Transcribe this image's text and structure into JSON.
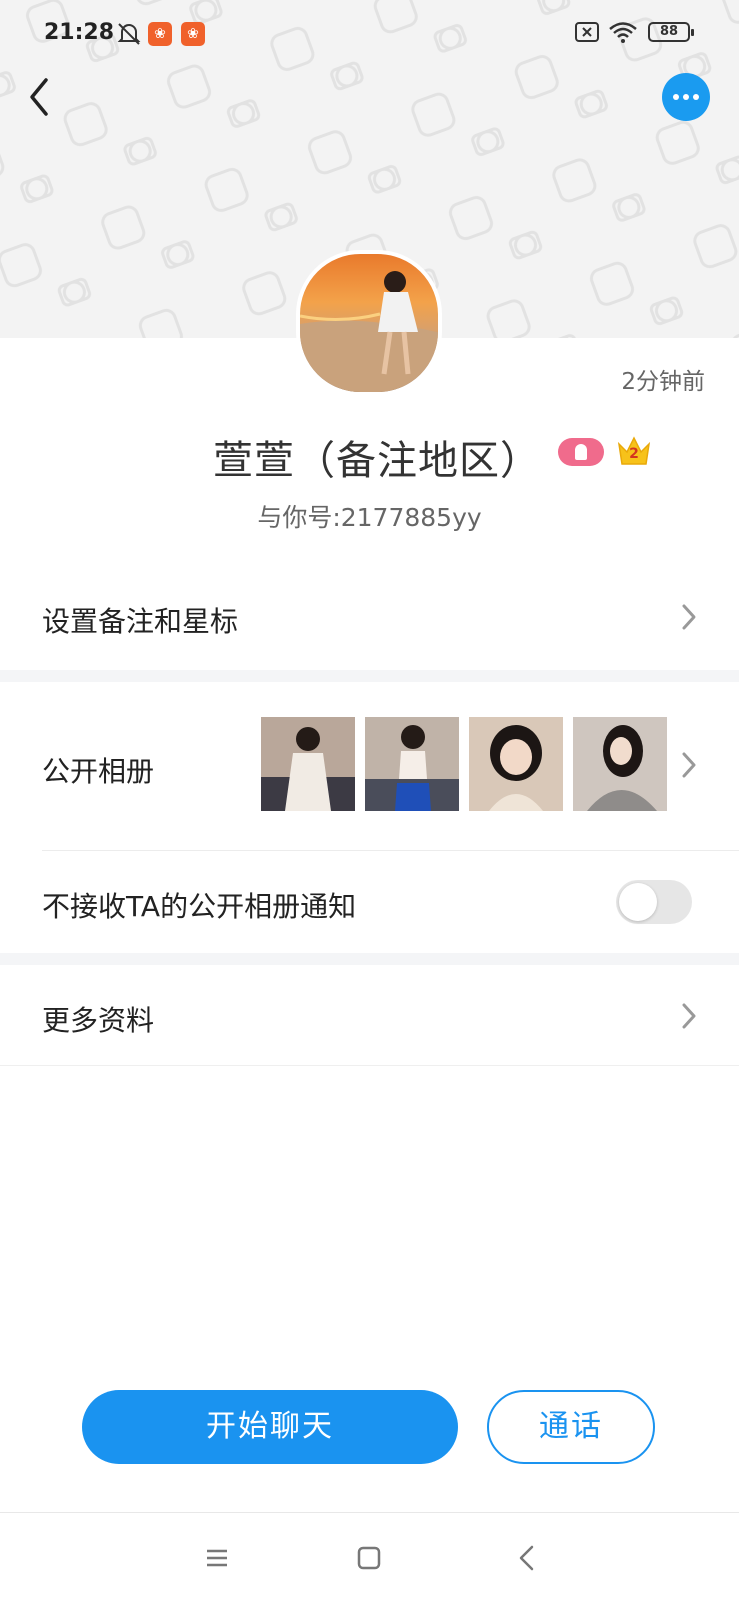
{
  "status_bar": {
    "time": "21:28",
    "battery": "88",
    "icons": [
      "bell-off-icon",
      "app-badge-icon",
      "app-badge-icon",
      "sim-x-icon",
      "wifi-icon",
      "battery-icon"
    ]
  },
  "header": {
    "back_icon": "chevron-left-icon",
    "more_icon": "more-dots-icon",
    "accent_color": "#1a9bf0"
  },
  "profile": {
    "last_seen": "2分钟前",
    "name": "萱萱（备注地区）",
    "account_id": "与你号:2177885yy",
    "badges": [
      "female-tag-icon",
      "crown-level-icon"
    ],
    "crown_level": "2"
  },
  "rows": {
    "remark": {
      "label": "设置备注和星标"
    },
    "album": {
      "label": "公开相册",
      "photo_count_shown": 4
    },
    "album_notify": {
      "label": "不接收TA的公开相册通知",
      "toggle_on": false
    },
    "more_info": {
      "label": "更多资料"
    }
  },
  "actions": {
    "chat_label": "开始聊天",
    "call_label": "通话"
  },
  "nav": [
    "menu-icon",
    "home-square-icon",
    "back-triangle-icon"
  ]
}
